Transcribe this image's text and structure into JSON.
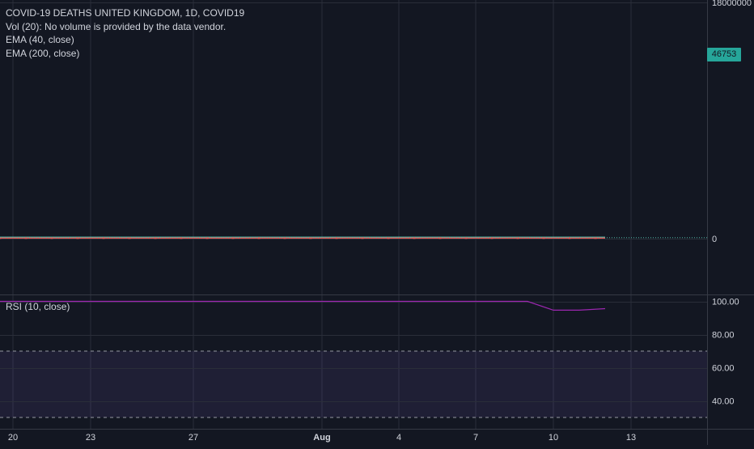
{
  "header": {
    "title": "COVID-19 DEATHS UNITED KINGDOM, 1D, COVID19",
    "vol_label": "Vol (20): No volume is provided by the data vendor.",
    "ema40_label": "EMA (40, close)",
    "ema200_label": "EMA (200, close)"
  },
  "rsi_panel": {
    "label": "RSI (10, close)"
  },
  "last_price": {
    "value_text": "46753",
    "color": "#26a69a",
    "text_color": "#131722"
  },
  "colors": {
    "background": "#131722",
    "grid": "#2a2e39",
    "axis_text": "#d1d4dc",
    "separator": "#363a45",
    "rsi_line": "#9c27b0",
    "rsi_band": "#7e57c2",
    "ema_line": "#4fb2a3",
    "candle": "#ef5350"
  },
  "chart_data": [
    {
      "type": "line",
      "title": "COVID-19 DEATHS UNITED KINGDOM, 1D, COVID19",
      "x_ticks": [
        "20",
        "23",
        "27",
        "Aug",
        "4",
        "7",
        "10",
        "13"
      ],
      "y_ticks": [
        "18000000",
        "0"
      ],
      "ylim": [
        0,
        18000000
      ],
      "last_value": 46753,
      "grid": true,
      "series": [
        {
          "name": "EMA (40, close)",
          "x": [
            "20",
            "23",
            "27",
            "Aug",
            "4",
            "7",
            "10",
            "12"
          ],
          "values": [
            46753,
            46753,
            46753,
            46753,
            46753,
            46753,
            46753,
            46753
          ]
        }
      ]
    },
    {
      "type": "line",
      "title": "RSI (10, close)",
      "x_ticks": [
        "20",
        "23",
        "27",
        "Aug",
        "4",
        "7",
        "10",
        "13"
      ],
      "y_ticks": [
        "100.00",
        "80.00",
        "60.00",
        "40.00"
      ],
      "ylim": [
        28,
        104
      ],
      "band": [
        30,
        70
      ],
      "series": [
        {
          "name": "RSI (10, close)",
          "x": [
            "20",
            "23",
            "27",
            "Aug",
            "4",
            "7",
            "9",
            "10",
            "11",
            "12"
          ],
          "values": [
            100,
            100,
            100,
            100,
            100,
            100,
            100,
            94.7,
            94.7,
            95.6
          ]
        }
      ]
    }
  ]
}
